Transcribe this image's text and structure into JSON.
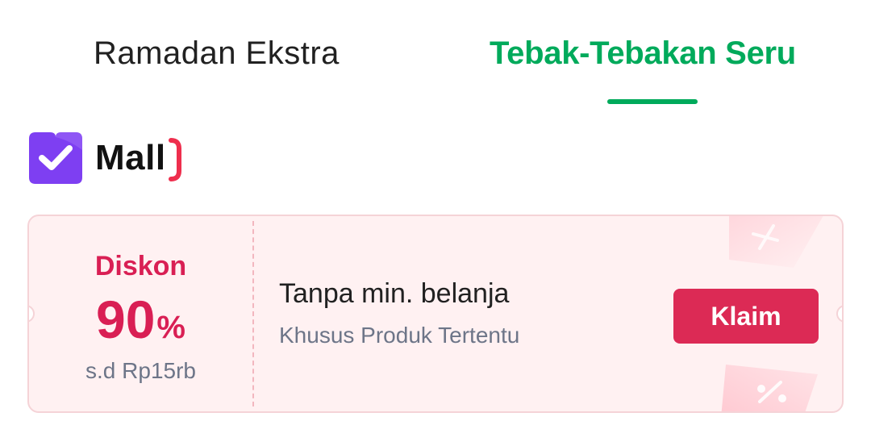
{
  "tabs": [
    {
      "label": "Ramadan Ekstra",
      "active": false
    },
    {
      "label": "Tebak-Tebakan Seru",
      "active": true
    }
  ],
  "mall": {
    "label": "Mall",
    "icon": "mall-check-bag-icon",
    "brand_color": "#7e3ff2",
    "accent_color": "#ee2e4d"
  },
  "voucher": {
    "title": "Diskon",
    "value": "90",
    "unit": "%",
    "cap": "s.d Rp15rb",
    "condition": "Tanpa min. belanja",
    "scope": "Khusus Produk Tertentu",
    "claim_label": "Klaim",
    "decoration_icon": "ticket-icon"
  },
  "colors": {
    "active_tab": "#00aa5b",
    "inactive_tab": "#212121",
    "discount": "#d91f54",
    "claim_button": "#dc2a55",
    "voucher_bg": "#fff1f2",
    "muted_text": "#6d7588"
  }
}
